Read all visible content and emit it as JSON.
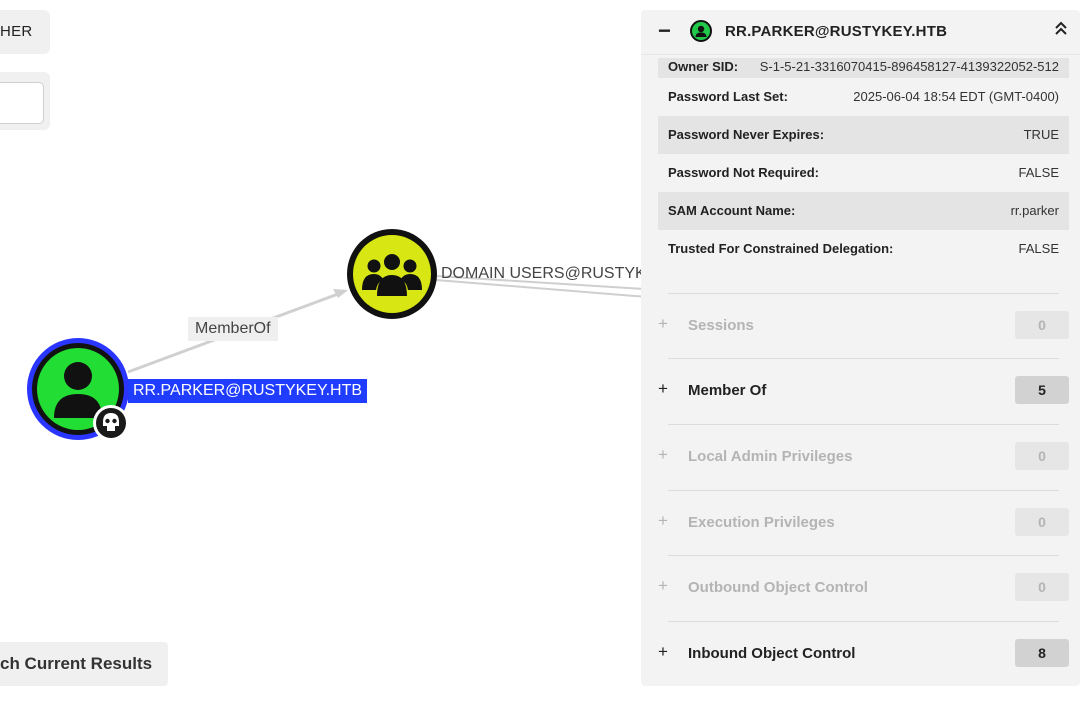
{
  "top_left": {
    "pill_label": "HER"
  },
  "search_button": {
    "label": "ch Current Results"
  },
  "graph": {
    "edge_label": "MemberOf",
    "user_node_label": "RR.PARKER@RUSTYKEY.HTB",
    "group_node_label": "DOMAIN USERS@RUSTYK",
    "colors": {
      "user_node": "#22dd33",
      "user_ring": "#2a35ff",
      "group_node": "#d8e614",
      "badge": "#1a1a1a"
    },
    "icons": {
      "user_node": "user-icon",
      "group_node": "group-icon",
      "badge": "skull-icon"
    }
  },
  "panel": {
    "collapse_symbol": "−",
    "title": "RR.PARKER@RUSTYKEY.HTB",
    "header_icon": "user-icon",
    "collapse_icon": "chevron-up-double-icon",
    "properties": [
      {
        "key": "Owner SID:",
        "value": "S-1-5-21-3316070415-896458127-4139322052-512"
      },
      {
        "key": "Password Last Set:",
        "value": "2025-06-04 18:54 EDT (GMT-0400)"
      },
      {
        "key": "Password Never Expires:",
        "value": "TRUE"
      },
      {
        "key": "Password Not Required:",
        "value": "FALSE"
      },
      {
        "key": "SAM Account Name:",
        "value": "rr.parker"
      },
      {
        "key": "Trusted For Constrained Delegation:",
        "value": "FALSE"
      }
    ],
    "sections": [
      {
        "label": "Sessions",
        "count": "0",
        "expand_symbol": "+"
      },
      {
        "label": "Member Of",
        "count": "5",
        "expand_symbol": "+"
      },
      {
        "label": "Local Admin Privileges",
        "count": "0",
        "expand_symbol": "+"
      },
      {
        "label": "Execution Privileges",
        "count": "0",
        "expand_symbol": "+"
      },
      {
        "label": "Outbound Object Control",
        "count": "0",
        "expand_symbol": "+"
      },
      {
        "label": "Inbound Object Control",
        "count": "8",
        "expand_symbol": "+"
      }
    ]
  }
}
